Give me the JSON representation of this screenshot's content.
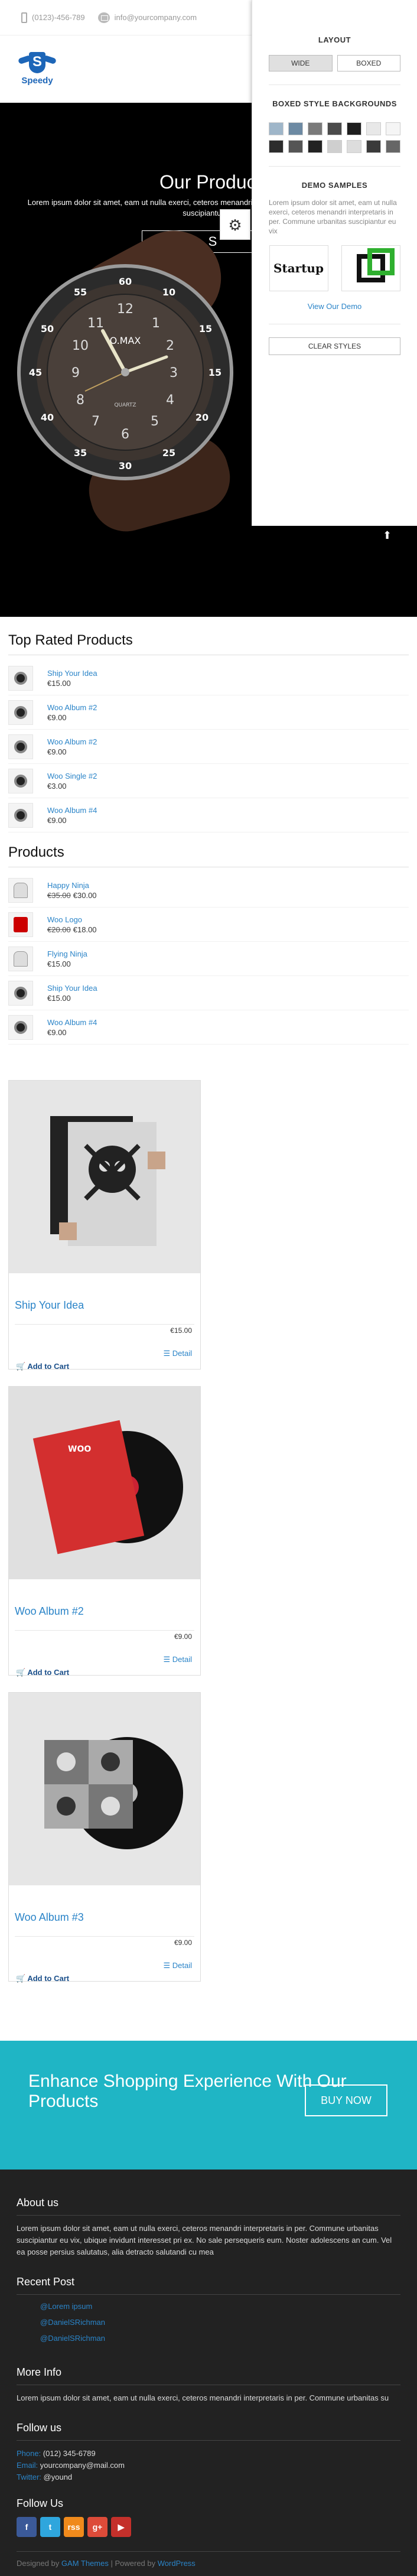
{
  "topbar": {
    "phone": "(0123)-456-789",
    "email": "info@yourcompany.com"
  },
  "logo": {
    "text": "Speedy"
  },
  "hero": {
    "title": "Our Products",
    "desc": "Lorem ipsum dolor sit amet, eam ut nulla exerci, ceteros menandri interpretaris in per. Commune urbanitas suscipiantur eu",
    "button": "S",
    "watch_brand": "O.MAX",
    "watch_sub": "QUARTZ"
  },
  "panel": {
    "layout_title": "LAYOUT",
    "wide": "WIDE",
    "boxed": "BOXED",
    "bg_title": "BOXED STYLE BACKGROUNDS",
    "swatches": [
      "#9fb6c9",
      "#6d8aa3",
      "#7a7a7a",
      "#4b4b4b",
      "#1e1e1e",
      "#e8e8e8",
      "#f5f5f5",
      "#2c2c2c",
      "#555555",
      "#222222",
      "#cfcfcf",
      "#dddddd",
      "#3a3a3a",
      "#666666"
    ],
    "demo_title": "DEMO SAMPLES",
    "demo_desc": "Lorem ipsum dolor sit amet, eam ut nulla exerci, ceteros menandri interpretaris in per. Commune urbanitas suscipiantur eu vix",
    "demo1": "Startup",
    "view_demo": "View Our Demo",
    "clear": "CLEAR STYLES"
  },
  "top_rated": {
    "title": "Top Rated Products",
    "items": [
      {
        "name": "Ship Your Idea",
        "price": "€15.00",
        "thumb": "disc"
      },
      {
        "name": "Woo Album #2",
        "price": "€9.00",
        "thumb": "disc"
      },
      {
        "name": "Woo Album #2",
        "price": "€9.00",
        "thumb": "disc"
      },
      {
        "name": "Woo Single #2",
        "price": "€3.00",
        "thumb": "disc"
      },
      {
        "name": "Woo Album #4",
        "price": "€9.00",
        "thumb": "disc"
      }
    ]
  },
  "products": {
    "title": "Products",
    "items": [
      {
        "name": "Happy Ninja",
        "old": "€35.00",
        "price": "€30.00",
        "thumb": "hood"
      },
      {
        "name": "Woo Logo",
        "old": "€20.00",
        "price": "€18.00",
        "thumb": "tee"
      },
      {
        "name": "Flying Ninja",
        "old": "",
        "price": "€15.00",
        "thumb": "hood"
      },
      {
        "name": "Ship Your Idea",
        "old": "",
        "price": "€15.00",
        "thumb": "disc"
      },
      {
        "name": "Woo Album #4",
        "old": "",
        "price": "€9.00",
        "thumb": "disc"
      }
    ]
  },
  "cards": [
    {
      "name": "Ship Your Idea",
      "price": "€15.00",
      "detail": "Detail",
      "cart": "Add to Cart",
      "art": "poster"
    },
    {
      "name": "Woo Album #2",
      "price": "€9.00",
      "detail": "Detail",
      "cart": "Add to Cart",
      "art": "red"
    },
    {
      "name": "Woo Album #3",
      "price": "€9.00",
      "detail": "Detail",
      "cart": "Add to Cart",
      "art": "gray"
    }
  ],
  "cta": {
    "text": "Enhance Shopping Experience With Our Products",
    "button": "BUY NOW"
  },
  "footer": {
    "about_title": "About us",
    "about_text": "Lorem ipsum dolor sit amet, eam ut nulla exerci, ceteros menandri interpretaris in per. Commune urbanitas suscipiantur eu vix, ubique invidunt interesset pri ex. No sale persequeris eum. Noster adolescens an cum. Vel ea posse persius salutatus, alia detracto salutandi cu mea",
    "recent_title": "Recent Post",
    "recent": [
      "@Lorem ipsum",
      "@DanielSRichman",
      "@DanielSRichman"
    ],
    "more_title": "More Info",
    "more_text": "Lorem ipsum dolor sit amet, eam ut nulla exerci, ceteros menandri interpretaris in per. Commune urbanitas su",
    "follow_title": "Follow us",
    "phone_label": "Phone:",
    "phone": "(012) 345-6789",
    "email_label": "Email:",
    "email": "yourcompany@mail.com",
    "twitter_label": "Twitter:",
    "twitter": "@yound",
    "follow2_title": "Follow Us",
    "social": [
      {
        "glyph": "f",
        "color": "#3b5998"
      },
      {
        "glyph": "t",
        "color": "#2fa6dd"
      },
      {
        "glyph": "rss",
        "color": "#f08a1c"
      },
      {
        "glyph": "g+",
        "color": "#dd4b39"
      },
      {
        "glyph": "▶",
        "color": "#c4302b"
      }
    ],
    "copyright_prefix": "Designed by",
    "copyright_link1": "GAM Themes",
    "copyright_mid": "| Powered by",
    "copyright_link2": "WordPress"
  }
}
